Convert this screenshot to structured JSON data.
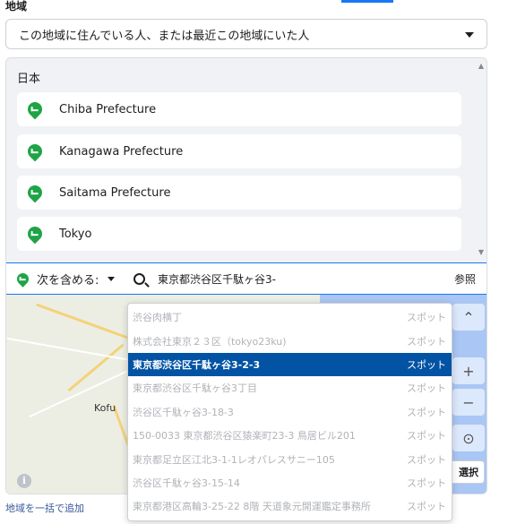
{
  "section": {
    "label": "地域"
  },
  "location_dropdown": {
    "value": "この地域に住んでいる人、または最近この地域にいた人"
  },
  "selected_locations": {
    "country": "日本",
    "items": [
      {
        "label": "Chiba Prefecture"
      },
      {
        "label": "Kanagawa Prefecture"
      },
      {
        "label": "Saitama Prefecture"
      },
      {
        "label": "Tokyo"
      }
    ]
  },
  "search": {
    "include_label": "次を含める:",
    "query": "東京都渋谷区千駄ヶ谷3-",
    "browse_label": "参照"
  },
  "map": {
    "city_label": "Kofu",
    "info_label": "i",
    "select_button": "選択"
  },
  "suggestions": [
    {
      "name": "渋谷肉横丁",
      "type": "スポット"
    },
    {
      "name": "株式会社東京２３区（tokyo23ku)",
      "type": "スポット"
    },
    {
      "name": "東京都渋谷区千駄ヶ谷3-2-3",
      "type": "スポット",
      "selected": true
    },
    {
      "name": "東京都渋谷区千駄ヶ谷3丁目",
      "type": "スポット"
    },
    {
      "name": "渋谷区千駄ヶ谷3-18-3",
      "type": "スポット"
    },
    {
      "name": "150-0033 東京都渋谷区猿楽町23-3 鳥居ビル201",
      "type": "スポット"
    },
    {
      "name": "東京都足立区江北3-1-1レオパレスサニー105",
      "type": "スポット"
    },
    {
      "name": "渋谷区千駄ヶ谷3-15-14",
      "type": "スポット"
    },
    {
      "name": "東京都港区高輪3-25-22 8階 天道象元開運鑑定事務所",
      "type": "スポット"
    }
  ],
  "footer": {
    "bulk_add_link": "地域を一括で追加"
  },
  "colors": {
    "accent": "#1877f2",
    "pin_green": "#1ea446",
    "selected_row": "#0353a4"
  }
}
